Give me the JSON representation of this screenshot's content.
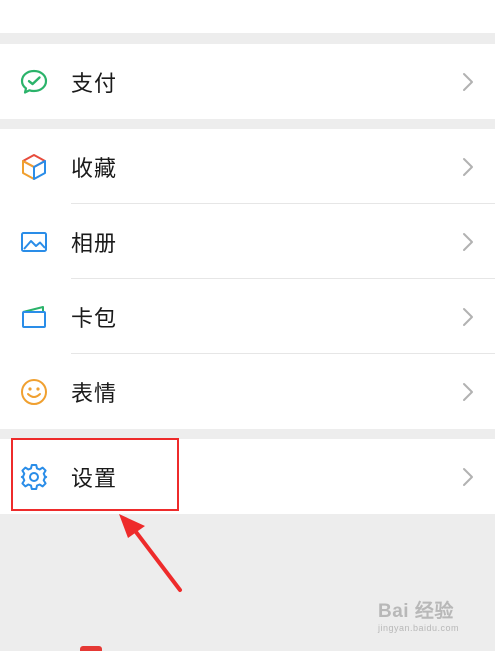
{
  "menu": {
    "pay": {
      "label": "支付",
      "icon": "wechat-pay-icon"
    },
    "favorites": {
      "label": "收藏",
      "icon": "favorites-cube-icon"
    },
    "album": {
      "label": "相册",
      "icon": "album-icon"
    },
    "cards": {
      "label": "卡包",
      "icon": "card-wallet-icon"
    },
    "stickers": {
      "label": "表情",
      "icon": "smiley-icon"
    },
    "settings": {
      "label": "设置",
      "icon": "gear-icon"
    }
  },
  "annotation": {
    "highlight_target": "settings",
    "color": "#ee2b2b"
  },
  "watermark": {
    "main": "Bai 经验",
    "sub": "jingyan.baidu.com"
  },
  "colors": {
    "background": "#ededed",
    "row": "#ffffff",
    "pay_green": "#2bb36a",
    "icon_blue": "#2a8de8",
    "smiley_orange": "#f0a030",
    "chevron": "#b2b2b2"
  }
}
